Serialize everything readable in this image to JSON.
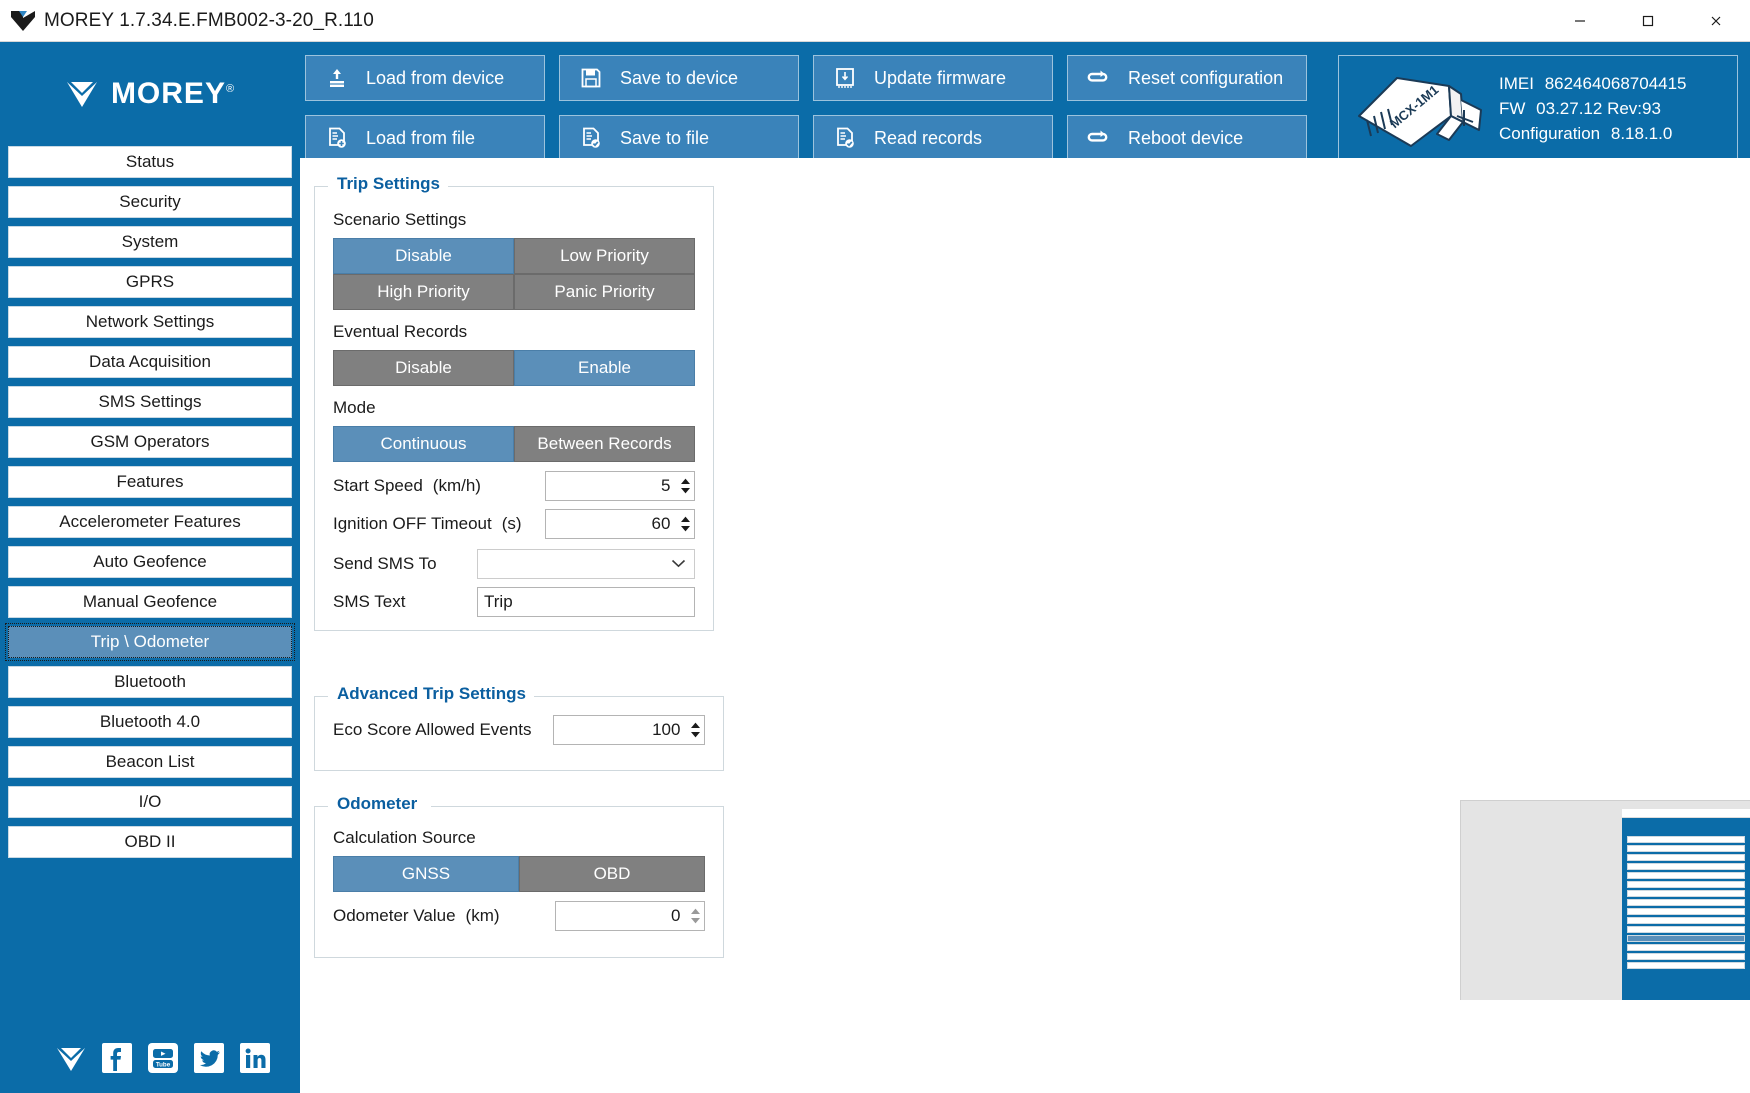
{
  "window": {
    "title": "MOREY 1.7.34.E.FMB002-3-20_R.110",
    "minimize_label": "Minimize",
    "maximize_label": "Maximize",
    "close_label": "Close"
  },
  "brand": {
    "name": "MOREY",
    "trademark": "®"
  },
  "toolbar": {
    "buttons": [
      {
        "label": "Load from device",
        "icon": "upload-to-device-icon"
      },
      {
        "label": "Save to device",
        "icon": "floppy-disk-icon"
      },
      {
        "label": "Update firmware",
        "icon": "firmware-chip-icon"
      },
      {
        "label": "Reset configuration",
        "icon": "reset-loop-icon"
      },
      {
        "label": "Load from file",
        "icon": "file-load-icon"
      },
      {
        "label": "Save to file",
        "icon": "file-save-icon"
      },
      {
        "label": "Read records",
        "icon": "file-records-icon"
      },
      {
        "label": "Reboot device",
        "icon": "reboot-loop-icon"
      }
    ]
  },
  "device_info": {
    "image_label": "MCX-1M1",
    "imei_key": "IMEI",
    "imei_value": "862464068704415",
    "fw_key": "FW",
    "fw_value": "03.27.12 Rev:93",
    "configuration_key": "Configuration",
    "configuration_value": "8.18.1.0"
  },
  "sidebar": {
    "items": [
      {
        "label": "Status",
        "selected": false
      },
      {
        "label": "Security",
        "selected": false
      },
      {
        "label": "System",
        "selected": false
      },
      {
        "label": "GPRS",
        "selected": false
      },
      {
        "label": "Network Settings",
        "selected": false
      },
      {
        "label": "Data Acquisition",
        "selected": false
      },
      {
        "label": "SMS Settings",
        "selected": false
      },
      {
        "label": "GSM Operators",
        "selected": false
      },
      {
        "label": "Features",
        "selected": false
      },
      {
        "label": "Accelerometer Features",
        "selected": false
      },
      {
        "label": "Auto Geofence",
        "selected": false
      },
      {
        "label": "Manual Geofence",
        "selected": false
      },
      {
        "label": "Trip \\ Odometer",
        "selected": true
      },
      {
        "label": "Bluetooth",
        "selected": false
      },
      {
        "label": "Bluetooth 4.0",
        "selected": false
      },
      {
        "label": "Beacon List",
        "selected": false
      },
      {
        "label": "I/O",
        "selected": false
      },
      {
        "label": "OBD II",
        "selected": false
      }
    ],
    "social": [
      {
        "name": "morey-mail-icon"
      },
      {
        "name": "facebook-icon"
      },
      {
        "name": "youtube-icon"
      },
      {
        "name": "twitter-icon"
      },
      {
        "name": "linkedin-icon"
      }
    ]
  },
  "trip_settings": {
    "title": "Trip Settings",
    "scenario_label": "Scenario Settings",
    "scenario_options": [
      {
        "label": "Disable",
        "selected": true
      },
      {
        "label": "Low Priority",
        "selected": false
      },
      {
        "label": "High Priority",
        "selected": false
      },
      {
        "label": "Panic Priority",
        "selected": false
      }
    ],
    "eventual_label": "Eventual Records",
    "eventual_options": [
      {
        "label": "Disable",
        "selected": false
      },
      {
        "label": "Enable",
        "selected": true
      }
    ],
    "mode_label": "Mode",
    "mode_options": [
      {
        "label": "Continuous",
        "selected": true
      },
      {
        "label": "Between Records",
        "selected": false
      }
    ],
    "start_speed_label": "Start Speed",
    "start_speed_unit": "(km/h)",
    "start_speed_value": "5",
    "ignition_off_label": "Ignition OFF Timeout",
    "ignition_off_unit": "(s)",
    "ignition_off_value": "60",
    "send_sms_label": "Send SMS To",
    "send_sms_value": "",
    "sms_text_label": "SMS Text",
    "sms_text_value": "Trip"
  },
  "advanced_trip_settings": {
    "title": "Advanced Trip Settings",
    "eco_score_label": "Eco Score Allowed Events",
    "eco_score_value": "100"
  },
  "odometer": {
    "title": "Odometer",
    "calculation_source_label": "Calculation Source",
    "calculation_source_options": [
      {
        "label": "GNSS",
        "selected": true
      },
      {
        "label": "OBD",
        "selected": false
      }
    ],
    "odometer_value_label": "Odometer Value",
    "odometer_value_unit": "(km)",
    "odometer_value": "0"
  },
  "colors": {
    "brand_blue": "#0b6ca8",
    "accent_blue": "#3a83ba",
    "selected_blue": "#5b8fb9",
    "segment_gray": "#808080",
    "group_title_blue": "#0b5fa0"
  }
}
